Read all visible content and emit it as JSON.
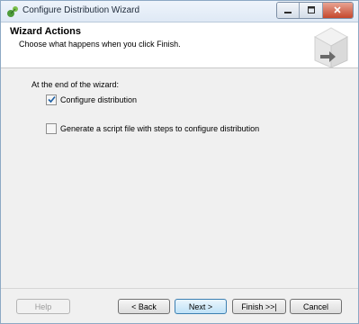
{
  "window": {
    "title": "Configure Distribution Wizard",
    "controls": {
      "minimize": "–",
      "maximize": "□",
      "close": "✕"
    }
  },
  "header": {
    "title": "Wizard Actions",
    "subtitle": "Choose what happens when you click Finish."
  },
  "content": {
    "label": "At the end of the wizard:",
    "options": [
      {
        "label": "Configure distribution",
        "checked": true
      },
      {
        "label": "Generate a script file with steps to configure distribution",
        "checked": false
      }
    ]
  },
  "buttons": {
    "help": "Help",
    "back": "< Back",
    "next": "Next >",
    "finish": "Finish >>|",
    "cancel": "Cancel"
  },
  "colors": {
    "accent": "#3c7fb1",
    "close": "#c5472c"
  },
  "icons": [
    "wizard-icon",
    "minimize-icon",
    "maximize-icon",
    "close-icon",
    "wizard-header-art",
    "checkmark-icon"
  ]
}
